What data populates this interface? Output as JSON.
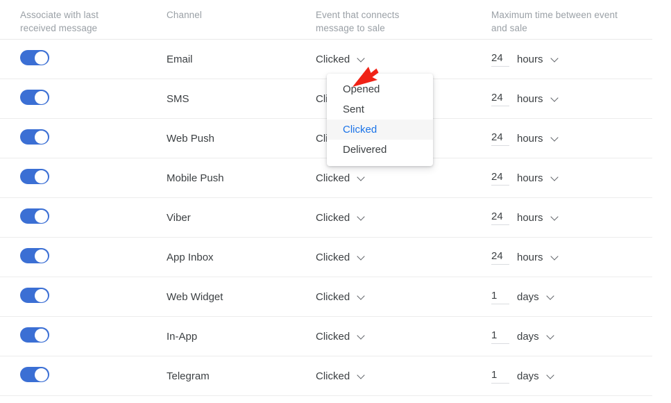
{
  "table": {
    "headers": {
      "toggle": "Associate with last\nreceived message",
      "channel": "Channel",
      "event": "Event that connects\nmessage to sale",
      "time": "Maximum time between event\nand sale"
    },
    "rows": [
      {
        "enabled": true,
        "channel": "Email",
        "event": "Clicked",
        "amount": "24",
        "unit": "hours"
      },
      {
        "enabled": true,
        "channel": "SMS",
        "event": "Clicked",
        "amount": "24",
        "unit": "hours"
      },
      {
        "enabled": true,
        "channel": "Web Push",
        "event": "Clicked",
        "amount": "24",
        "unit": "hours"
      },
      {
        "enabled": true,
        "channel": "Mobile Push",
        "event": "Clicked",
        "amount": "24",
        "unit": "hours"
      },
      {
        "enabled": true,
        "channel": "Viber",
        "event": "Clicked",
        "amount": "24",
        "unit": "hours"
      },
      {
        "enabled": true,
        "channel": "App Inbox",
        "event": "Clicked",
        "amount": "24",
        "unit": "hours"
      },
      {
        "enabled": true,
        "channel": "Web Widget",
        "event": "Clicked",
        "amount": "1",
        "unit": "days"
      },
      {
        "enabled": true,
        "channel": "In-App",
        "event": "Clicked",
        "amount": "1",
        "unit": "days"
      },
      {
        "enabled": true,
        "channel": "Telegram",
        "event": "Clicked",
        "amount": "1",
        "unit": "days"
      }
    ]
  },
  "dropdown": {
    "open": true,
    "selected": "Clicked",
    "options": [
      "Opened",
      "Sent",
      "Clicked",
      "Delivered"
    ]
  },
  "annotation": {
    "arrow_color": "#f02216"
  },
  "colors": {
    "toggle_on": "#3b6fd4",
    "accent": "#1a73e8",
    "text": "#3c4043",
    "muted": "#9aa0a6",
    "divider": "#ececec"
  }
}
